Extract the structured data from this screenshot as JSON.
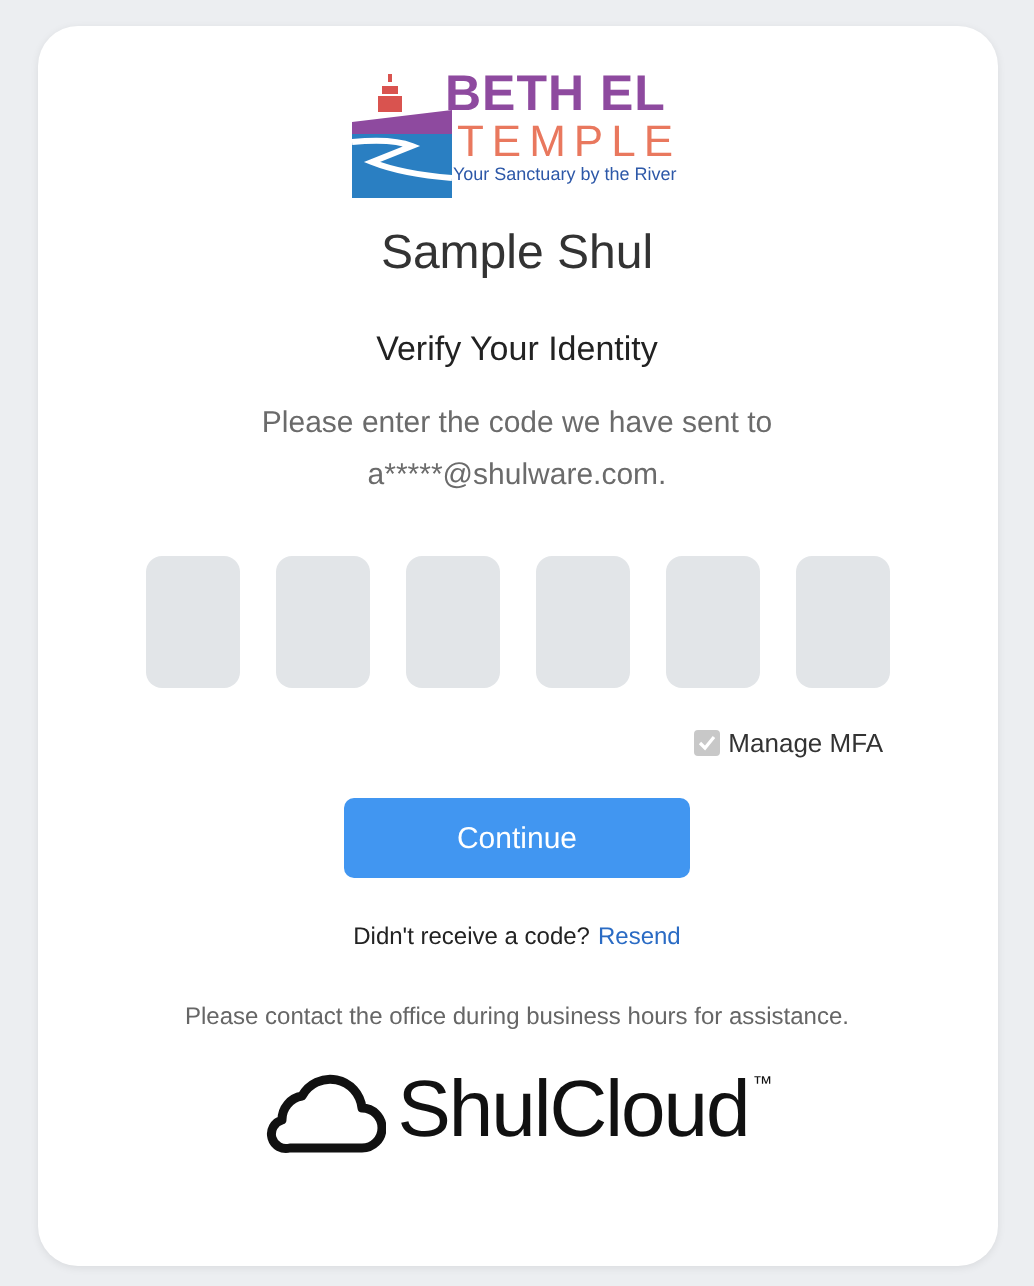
{
  "logo": {
    "line_1": "BETH EL",
    "line_2": "TEMPLE",
    "tagline": "Your Sanctuary by the River"
  },
  "title": "Sample Shul",
  "heading": "Verify Your Identity",
  "instructions": "Please enter the code we have sent to a*****@shulware.com.",
  "code_digits": [
    {
      "kind": "digit"
    },
    {
      "kind": "digit"
    },
    {
      "kind": "digit"
    },
    {
      "kind": "digit"
    },
    {
      "kind": "digit"
    },
    {
      "kind": "digit"
    }
  ],
  "manage_mfa": {
    "label": "Manage MFA",
    "checked": true,
    "disabled": true
  },
  "continue_button": "Continue",
  "resend": {
    "prompt": "Didn't receive a code?",
    "link": "Resend"
  },
  "help_text": "Please contact the office during business hours for assistance.",
  "footer_logo": {
    "name": "ShulCloud",
    "trademark": "™"
  }
}
